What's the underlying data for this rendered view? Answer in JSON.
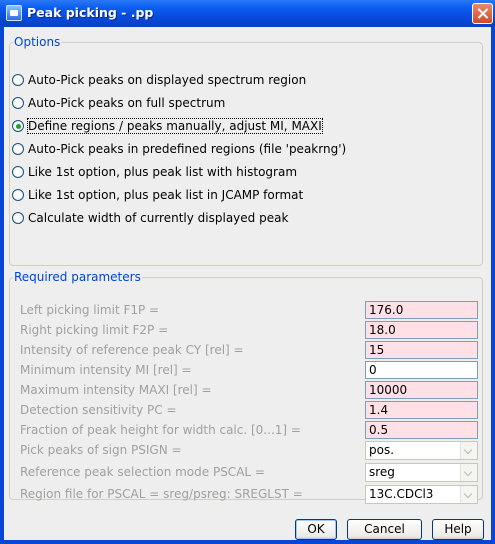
{
  "window": {
    "title": "Peak picking - .pp"
  },
  "options": {
    "legend": "Options",
    "items": [
      {
        "label": "Auto-Pick peaks on displayed spectrum region",
        "selected": false
      },
      {
        "label": "Auto-Pick peaks on full spectrum",
        "selected": false
      },
      {
        "label": "Define regions / peaks manually, adjust MI, MAXI",
        "selected": true
      },
      {
        "label": "Auto-Pick peaks in predefined regions (file 'peakrng')",
        "selected": false
      },
      {
        "label": "Like 1st option, plus peak list with histogram",
        "selected": false
      },
      {
        "label": "Like 1st option, plus peak list in JCAMP format",
        "selected": false
      },
      {
        "label": "Calculate width of currently displayed peak",
        "selected": false
      }
    ]
  },
  "params": {
    "legend": "Required parameters",
    "rows": [
      {
        "label": "Left picking limit F1P =",
        "value": "176.0",
        "kind": "input"
      },
      {
        "label": "Right picking limit F2P =",
        "value": "18.0",
        "kind": "input"
      },
      {
        "label": "Intensity of reference peak CY [rel] =",
        "value": "15",
        "kind": "input"
      },
      {
        "label": "Minimum intensity MI [rel] =",
        "value": "0",
        "kind": "input-white"
      },
      {
        "label": "Maximum intensity MAXI [rel] =",
        "value": "10000",
        "kind": "input"
      },
      {
        "label": "Detection sensitivity PC =",
        "value": "1.4",
        "kind": "input"
      },
      {
        "label": "Fraction of peak height for width calc. [0...1] =",
        "value": "0.5",
        "kind": "input"
      },
      {
        "label": "Pick peaks of sign PSIGN =",
        "value": "pos.",
        "kind": "select"
      },
      {
        "label": "Reference peak selection mode PSCAL =",
        "value": "sreg",
        "kind": "select"
      },
      {
        "label": "Region file for PSCAL = sreg/psreg: SREGLST =",
        "value": "13C.CDCl3",
        "kind": "select"
      }
    ]
  },
  "buttons": {
    "ok": "OK",
    "cancel": "Cancel",
    "help": "Help"
  },
  "colors": {
    "title_bar": "#0a5cf0",
    "legend_text": "#0046d5",
    "required_field": "#ffe0e6",
    "disabled_label": "#a0a0a0",
    "dialog_background": "#eeeeee"
  }
}
